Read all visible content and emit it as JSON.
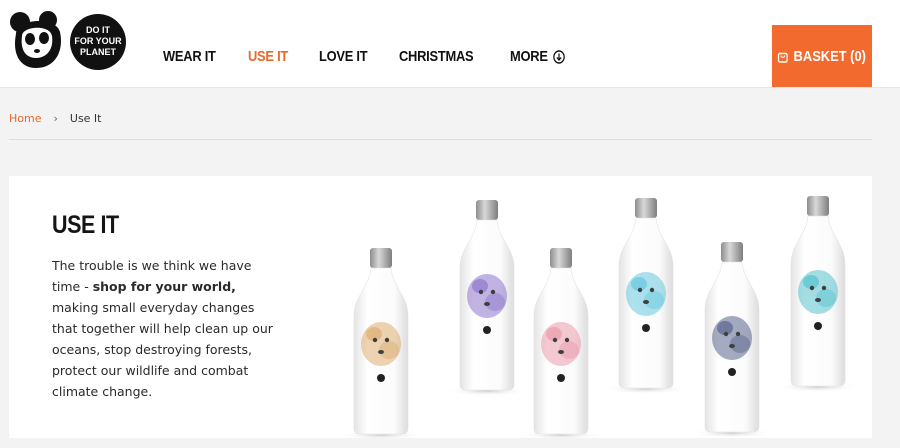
{
  "logo": {
    "badge_line1": "DO IT",
    "badge_line2": "FOR YOUR",
    "badge_line3": "PLANET"
  },
  "nav": {
    "items": [
      {
        "label": "WEAR IT"
      },
      {
        "label": "USE IT"
      },
      {
        "label": "LOVE IT"
      },
      {
        "label": "CHRISTMAS"
      },
      {
        "label": "MORE"
      }
    ]
  },
  "basket": {
    "label": "BASKET (0)"
  },
  "breadcrumb": {
    "home": "Home",
    "separator": "›",
    "current": "Use It"
  },
  "hero": {
    "title": "USE IT",
    "text_before": "The trouble is we think we have time - ",
    "text_bold": "shop for your world,",
    "text_after": " making small everyday changes that together will help clean up our oceans, stop destroying forests, protect our wildlife and combat climate change."
  },
  "bottles": [
    {
      "animal": "tiger",
      "accent": "#d8a15a"
    },
    {
      "animal": "elephant",
      "accent": "#7a5fc4"
    },
    {
      "animal": "panda",
      "accent": "#e88a9c"
    },
    {
      "animal": "polar-bear",
      "accent": "#4cc0d9"
    },
    {
      "animal": "rhino",
      "accent": "#3d4a7a"
    },
    {
      "animal": "snow-leopard",
      "accent": "#3cb8c6"
    }
  ],
  "colors": {
    "accent": "#f26a2e",
    "active_nav": "#e8692a"
  }
}
